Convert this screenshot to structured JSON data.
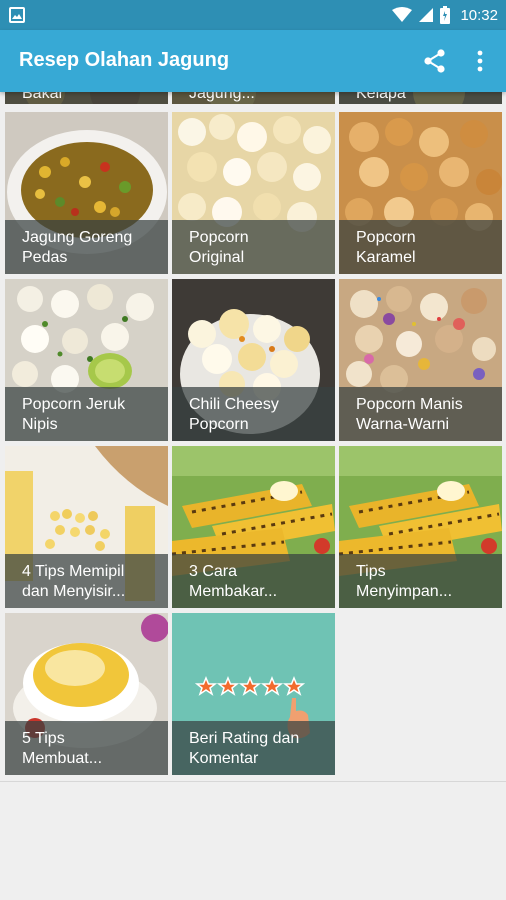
{
  "status_bar": {
    "time": "10:32",
    "icons": [
      "image-icon",
      "wifi-icon",
      "signal-icon",
      "battery-icon"
    ]
  },
  "app_bar": {
    "title": "Resep Olahan Jagung",
    "actions": [
      "share-icon",
      "more-vert-icon"
    ]
  },
  "colors": {
    "status_bar": "#2e8fb4",
    "app_bar": "#37a9d5",
    "caption_overlay": "#374141",
    "rating_card": "#6fc3b4",
    "rating_star": "#f26b2d"
  },
  "partial_row": [
    {
      "label": "Bakar"
    },
    {
      "label": "Jagung..."
    },
    {
      "label": "Kelapa"
    }
  ],
  "recipes": [
    {
      "label": "Jagung Goreng\nPedas"
    },
    {
      "label": "Popcorn\nOriginal"
    },
    {
      "label": "Popcorn\nKaramel"
    },
    {
      "label": "Popcorn Jeruk\nNipis"
    },
    {
      "label": "Chili Cheesy\nPopcorn"
    },
    {
      "label": "Popcorn Manis\nWarna-Warni"
    },
    {
      "label": "4 Tips Memipil\ndan Menyisir..."
    },
    {
      "label": "3 Cara\nMembakar..."
    },
    {
      "label": "Tips\nMenyimpan..."
    },
    {
      "label": "5 Tips\nMembuat..."
    },
    {
      "label": "Beri Rating dan\nKomentar",
      "icon": "rating-stars-icon"
    }
  ]
}
